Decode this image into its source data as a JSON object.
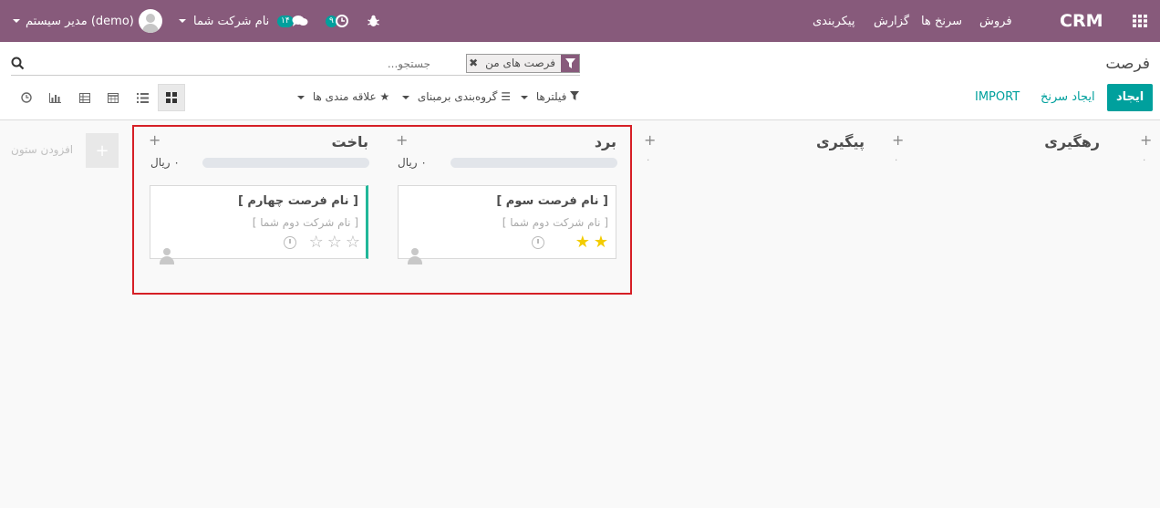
{
  "navbar": {
    "apps_icon": "grid-icon",
    "brand": "CRM",
    "menu": [
      "فروش",
      "سرنخ ها",
      "گزارش",
      "پیکربندی"
    ],
    "bug_icon": "bug-icon",
    "activity_count": "۹",
    "messages_count": "۱۴",
    "company": "نام شرکت شما",
    "user": "مدیر سیستم (demo)",
    "color": "#875a7b"
  },
  "control_panel": {
    "breadcrumb": "فرصت",
    "facet_label": "فرصت های من",
    "search_placeholder": "جستجو...",
    "create_label": "ایجاد",
    "create_lead_label": "ایجاد سرنخ",
    "import_label": "IMPORT",
    "filters_label": "فیلترها",
    "groupby_label": "گروه‌بندی برمبنای",
    "favorites_label": "علاقه مندی ها",
    "views": [
      "kanban-icon",
      "list-icon",
      "calendar-icon",
      "pivot-icon",
      "graph-icon",
      "activity-icon"
    ],
    "accent_color": "#00a09d"
  },
  "kanban": {
    "columns": [
      {
        "title": "رهگیری",
        "amount": "۰"
      },
      {
        "title": "پیگیری",
        "amount": "۰"
      },
      {
        "title": "برد",
        "amount": "۰ ریال"
      },
      {
        "title": "باخت",
        "amount": "۰ ریال"
      }
    ],
    "cards": [
      {
        "title": "[ نام فرصت سوم ]",
        "company": "[ نام شرکت دوم شما ]",
        "stars": 2
      },
      {
        "title": "[ نام فرصت چهارم ]",
        "company": "[ نام شرکت دوم شما ]",
        "stars": 0
      }
    ],
    "add_column_label": "افزودن ستون"
  }
}
